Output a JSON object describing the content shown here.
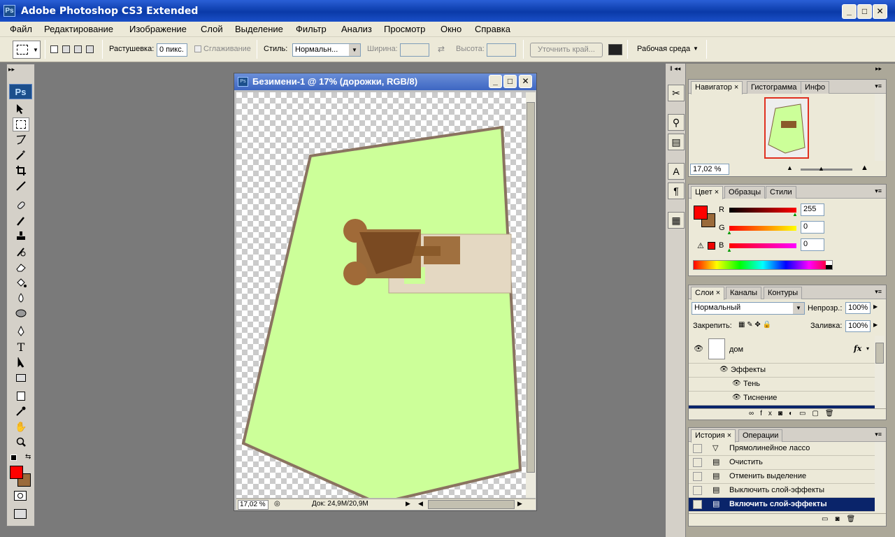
{
  "window": {
    "title": "Adobe Photoshop CS3 Extended",
    "app_icon": "Ps"
  },
  "menu": [
    "Файл",
    "Редактирование",
    "Изображение",
    "Слой",
    "Выделение",
    "Фильтр",
    "Анализ",
    "Просмотр",
    "Окно",
    "Справка"
  ],
  "options": {
    "feather_label": "Растушевка:",
    "feather_value": "0 пикс.",
    "antialias_label": "Сглаживание",
    "style_label": "Стиль:",
    "style_value": "Нормальн...",
    "width_label": "Ширина:",
    "height_label": "Высота:",
    "refine_edge": "Уточнить край...",
    "workspace": "Рабочая среда"
  },
  "document": {
    "title": "Безимени-1 @ 17% (дорожки, RGB/8)",
    "zoom": "17,02 %",
    "doc_info": "Док: 24,9M/20,9M"
  },
  "navigator": {
    "tabs": [
      "Навигатор",
      "Гистограмма",
      "Инфо"
    ],
    "zoom": "17,02 %",
    "zoom_slider": 0.4
  },
  "color": {
    "tabs": [
      "Цвет",
      "Образцы",
      "Стили"
    ],
    "channels": [
      {
        "label": "R",
        "value": "255"
      },
      {
        "label": "G",
        "value": "0"
      },
      {
        "label": "B",
        "value": "0"
      }
    ],
    "foreground": "#ff0000",
    "background": "#9a6a3a"
  },
  "layers": {
    "tabs": [
      "Слои",
      "Каналы",
      "Контуры"
    ],
    "blend_mode": "Нормальный",
    "opacity_label": "Непрозр.:",
    "opacity": "100%",
    "lock_label": "Закрепить:",
    "fill_label": "Заливка:",
    "fill": "100%",
    "layer_name": "дом",
    "fx": "fx",
    "effects_label": "Эффекты",
    "effects": [
      "Тень",
      "Тиснение"
    ]
  },
  "history": {
    "tabs": [
      "История",
      "Операции"
    ],
    "items": [
      "Прямолинейное лассо",
      "Очистить",
      "Отменить выделение",
      "Выключить слой-эффекты",
      "Включить слой-эффекты"
    ],
    "selected_index": 4
  },
  "colors": {
    "titlebar": "#0a3aa8",
    "canvas_green": "#ccff99",
    "selected": "#0a246a"
  }
}
